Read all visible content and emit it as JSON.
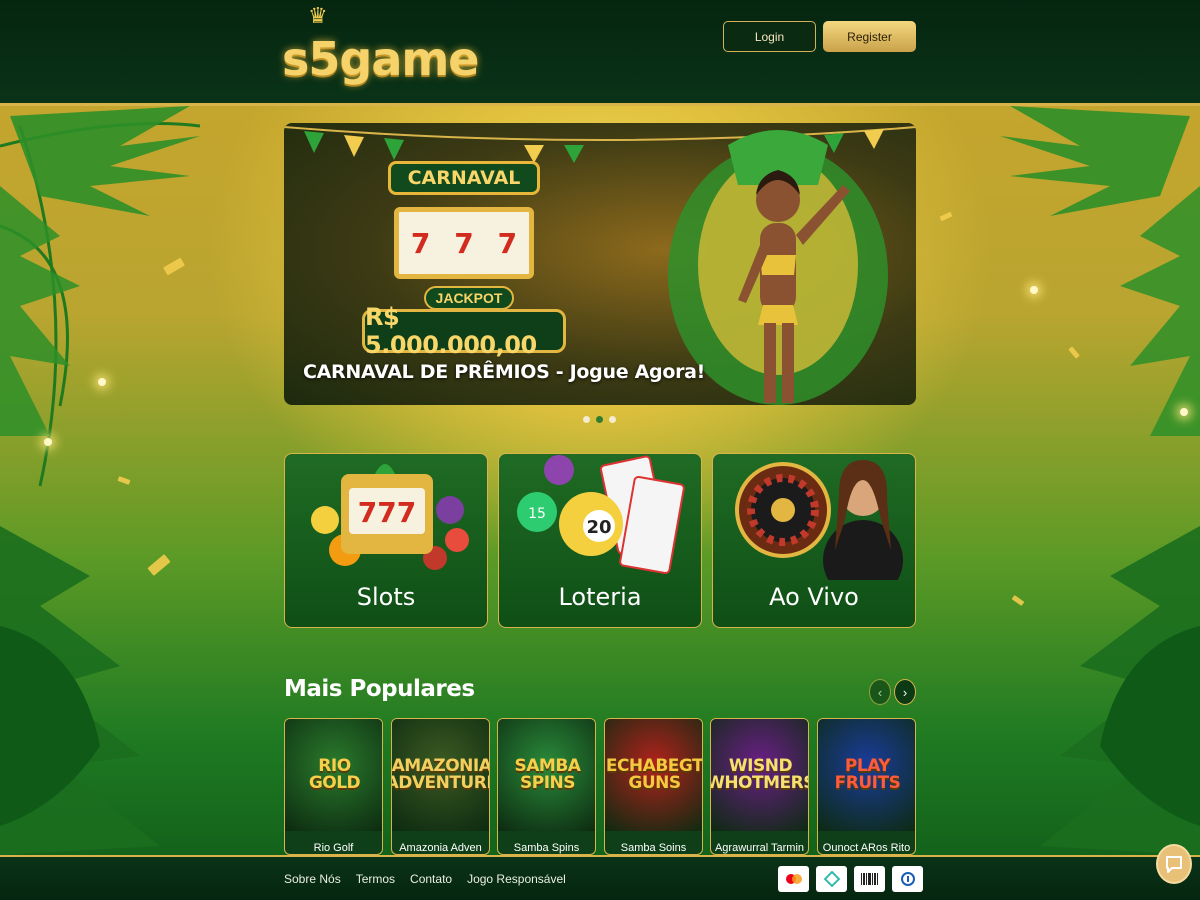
{
  "header": {
    "logo_text": "s5game",
    "login_label": "Login",
    "register_label": "Register"
  },
  "hero": {
    "sign_text": "CARNAVAL",
    "reels": [
      "7",
      "7",
      "7"
    ],
    "jackpot_label": "JACKPOT",
    "jackpot_amount": "R$ 5.000.000,00",
    "caption": "CARNAVAL DE PRÊMIOS - Jogue Agora!",
    "slides": 3,
    "active_slide": 2
  },
  "categories": [
    {
      "label": "Slots"
    },
    {
      "label": "Loteria"
    },
    {
      "label": "Ao Vivo"
    }
  ],
  "popular": {
    "title": "Mais Populares",
    "prev_icon": "chevron-left-icon",
    "next_icon": "chevron-right-icon",
    "games": [
      {
        "thumb": "RIO\nGOLD",
        "name": "Rio Golf",
        "bg": "#2a7a2c",
        "fg": "#f6d04a"
      },
      {
        "thumb": "AMAZONIA\nADVENTURE",
        "name": "Amazonia Adven",
        "bg": "#3c5a22",
        "fg": "#f2d060"
      },
      {
        "thumb": "SAMBA\nSPINS",
        "name": "Samba Spins",
        "bg": "#2a8a3a",
        "fg": "#f6d04a"
      },
      {
        "thumb": "ECHABEGT\nGUNS",
        "name": "Samba Soins",
        "bg": "#b0221c",
        "fg": "#f6c840"
      },
      {
        "thumb": "WISND\nWHOTMERS",
        "name": "Agrawurral Tarmin",
        "bg": "#6a1f86",
        "fg": "#f6e070"
      },
      {
        "thumb": "PLAY\nFRUITS",
        "name": "Ounoct ARos Rito",
        "bg": "#1a3c9a",
        "fg": "#ff5a3a"
      }
    ]
  },
  "footer": {
    "links": [
      "Sobre Nós",
      "Termos",
      "Contato",
      "Jogo Responsável"
    ],
    "payment_badges": [
      "mastercard-icon",
      "pix-icon",
      "barcode-icon",
      "bank-icon"
    ]
  },
  "chat_icon": "chat-bubble-icon"
}
